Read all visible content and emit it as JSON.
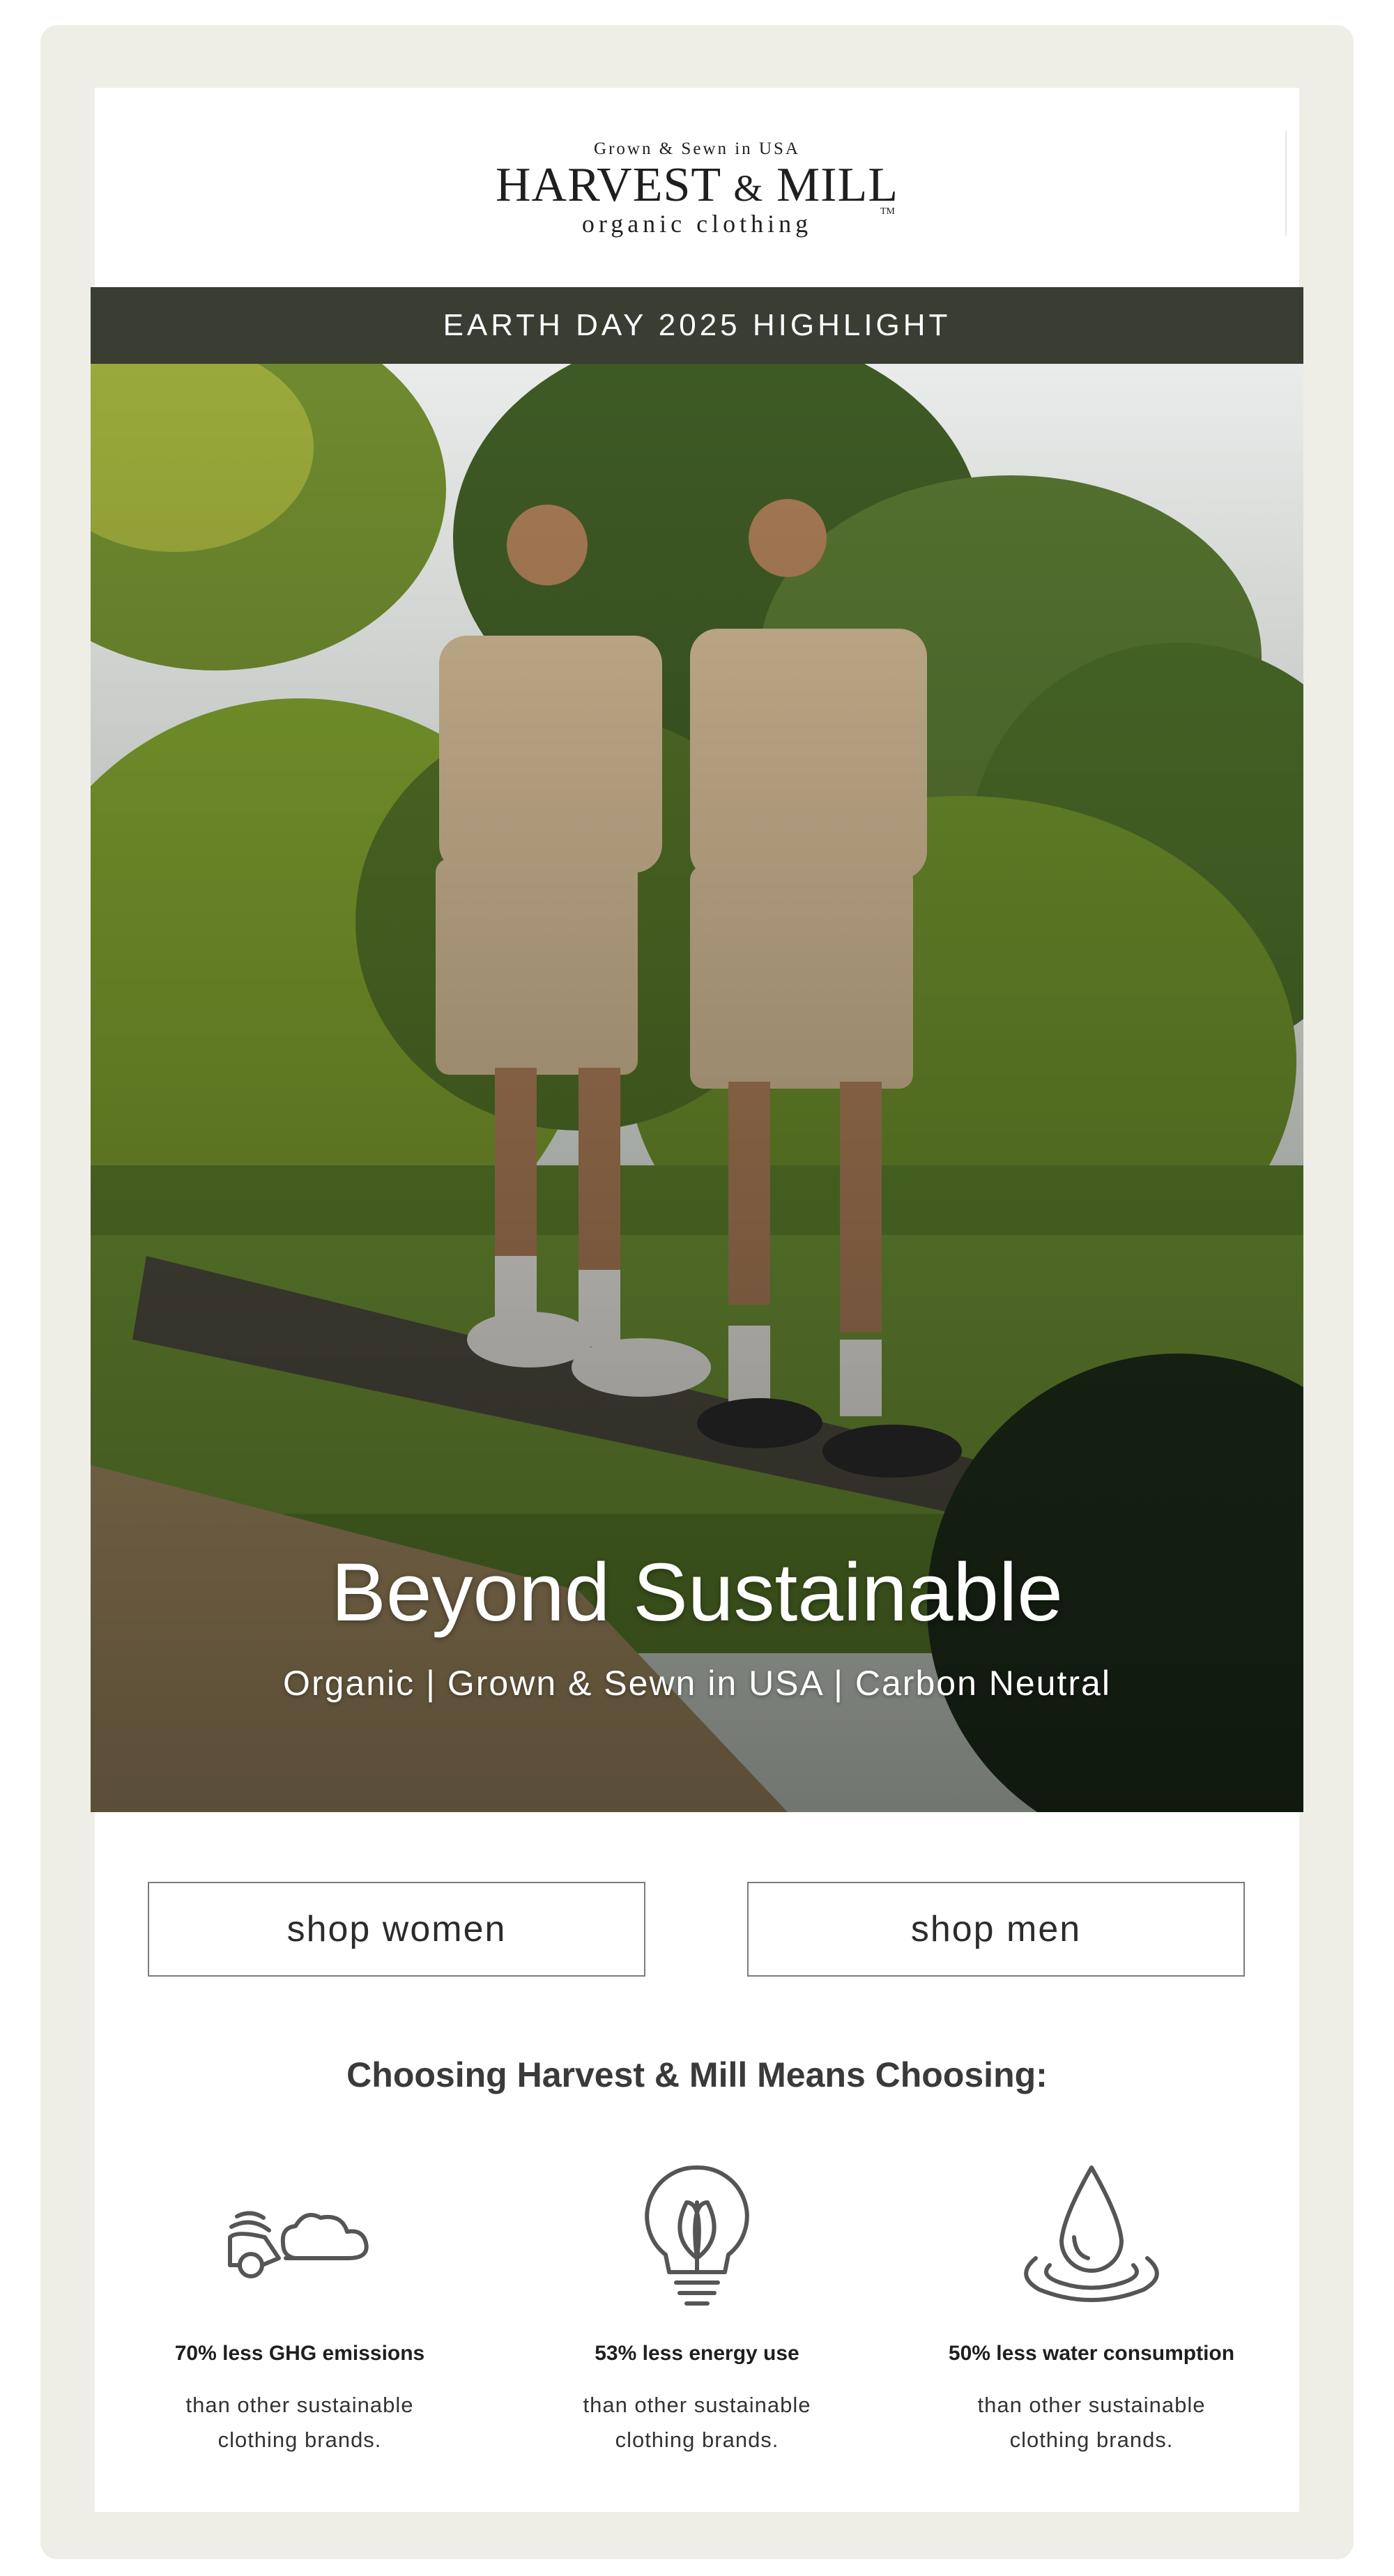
{
  "brand": {
    "tagline_top": "Grown & Sewn in USA",
    "name_left": "HARVEST",
    "name_amp": "&",
    "name_right": "MILL",
    "subtitle": "organic clothing",
    "tm": "TM"
  },
  "banner": {
    "text": "EARTH DAY 2025 HIGHLIGHT"
  },
  "hero": {
    "image_icon": "photo-two-models-outdoors",
    "title": "Beyond Sustainable",
    "subtitle": "Organic | Grown & Sewn in USA | Carbon Neutral"
  },
  "buttons": {
    "women": "shop women",
    "men": "shop men"
  },
  "benefits_section": {
    "title": "Choosing Harvest & Mill Means Choosing:",
    "items": [
      {
        "icon": "car-cloud-icon",
        "title": "70% less GHG emissions",
        "text": "than other sustainable clothing brands."
      },
      {
        "icon": "lightbulb-leaf-icon",
        "title": "53% less energy use",
        "text": "than other sustainable clothing brands."
      },
      {
        "icon": "water-drop-icon",
        "title": "50% less water consumption",
        "text": "than other sustainable clothing brands."
      }
    ]
  },
  "colors": {
    "page_frame": "#efeee6",
    "banner_bg": "#393d32",
    "text_dark": "#3a3a3a"
  }
}
